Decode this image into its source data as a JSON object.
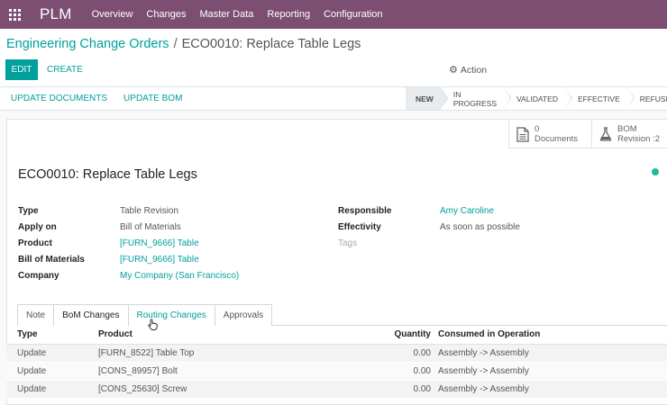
{
  "navbar": {
    "brand": "PLM",
    "menu": [
      "Overview",
      "Changes",
      "Master Data",
      "Reporting",
      "Configuration"
    ],
    "apps_icon": "grid-icon"
  },
  "breadcrumb": {
    "parent": "Engineering Change Orders",
    "separator": "/",
    "current": "ECO0010: Replace Table Legs"
  },
  "control": {
    "edit_label": "EDIT",
    "create_label": "CREATE",
    "action_label": "Action",
    "action_icon": "gear-icon"
  },
  "header": {
    "update_documents_label": "UPDATE DOCUMENTS",
    "update_bom_label": "UPDATE BOM",
    "stages": [
      {
        "label": "NEW",
        "active": true
      },
      {
        "label": "IN PROGRESS",
        "active": false
      },
      {
        "label": "VALIDATED",
        "active": false
      },
      {
        "label": "EFFECTIVE",
        "active": false
      },
      {
        "label": "REFUSED",
        "active": false
      }
    ]
  },
  "smart_buttons": {
    "documents_count": "0",
    "documents_label": "Documents",
    "documents_icon": "file-icon",
    "bom_line1": "BOM",
    "bom_line2": "Revision :2",
    "bom_icon": "flask-icon"
  },
  "record": {
    "title": "ECO0010: Replace Table Legs",
    "status_color": "#21b799"
  },
  "fields_left": [
    {
      "label": "Type",
      "value": "Table Revision",
      "link": false
    },
    {
      "label": "Apply on",
      "value": "Bill of Materials",
      "link": false
    },
    {
      "label": "Product",
      "value": "[FURN_9666] Table",
      "link": true
    },
    {
      "label": "Bill of Materials",
      "value": "[FURN_9666] Table",
      "link": true
    },
    {
      "label": "Company",
      "value": "My Company (San Francisco)",
      "link": true
    }
  ],
  "fields_right": [
    {
      "label": "Responsible",
      "value": "Amy Caroline",
      "link": true
    },
    {
      "label": "Effectivity",
      "value": "As soon as possible",
      "link": false
    },
    {
      "label": "Tags",
      "value": "",
      "link": false
    }
  ],
  "tabs": [
    {
      "label": "Note",
      "active": false
    },
    {
      "label": "BoM Changes",
      "active": true
    },
    {
      "label": "Routing Changes",
      "active": false
    },
    {
      "label": "Approvals",
      "active": false
    }
  ],
  "table": {
    "columns": [
      "Type",
      "Product",
      "Quantity",
      "Consumed in Operation"
    ],
    "rows": [
      {
        "type": "Update",
        "product": "[FURN_8522] Table Top",
        "quantity": "0.00",
        "operation": "Assembly -> Assembly"
      },
      {
        "type": "Update",
        "product": "[CONS_89957] Bolt",
        "quantity": "0.00",
        "operation": "Assembly -> Assembly"
      },
      {
        "type": "Update",
        "product": "[CONS_25630] Screw",
        "quantity": "0.00",
        "operation": "Assembly -> Assembly"
      }
    ]
  },
  "colors": {
    "navbar": "#7c4e72",
    "accent": "#00a09d"
  }
}
